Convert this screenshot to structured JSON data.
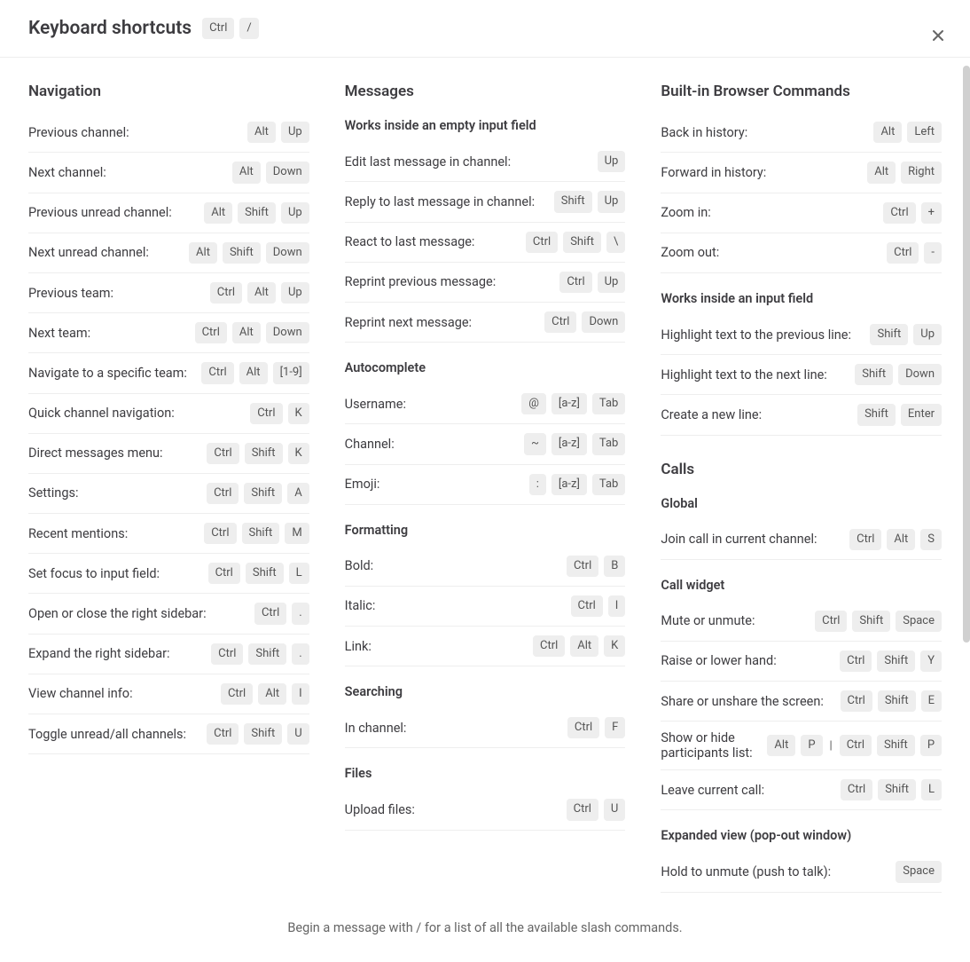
{
  "header": {
    "title": "Keyboard shortcuts",
    "keys": [
      "Ctrl",
      "/"
    ]
  },
  "footer": "Begin a message with / for a list of all the available slash commands.",
  "columns": [
    {
      "sections": [
        {
          "title": "Navigation",
          "groups": [
            {
              "rows": [
                {
                  "label": "Previous channel:",
                  "keys": [
                    "Alt",
                    "Up"
                  ]
                },
                {
                  "label": "Next channel:",
                  "keys": [
                    "Alt",
                    "Down"
                  ]
                },
                {
                  "label": "Previous unread channel:",
                  "keys": [
                    "Alt",
                    "Shift",
                    "Up"
                  ]
                },
                {
                  "label": "Next unread channel:",
                  "keys": [
                    "Alt",
                    "Shift",
                    "Down"
                  ]
                },
                {
                  "label": "Previous team:",
                  "keys": [
                    "Ctrl",
                    "Alt",
                    "Up"
                  ]
                },
                {
                  "label": "Next team:",
                  "keys": [
                    "Ctrl",
                    "Alt",
                    "Down"
                  ]
                },
                {
                  "label": "Navigate to a specific team:",
                  "keys": [
                    "Ctrl",
                    "Alt",
                    "[1-9]"
                  ]
                },
                {
                  "label": "Quick channel navigation:",
                  "keys": [
                    "Ctrl",
                    "K"
                  ]
                },
                {
                  "label": "Direct messages menu:",
                  "keys": [
                    "Ctrl",
                    "Shift",
                    "K"
                  ]
                },
                {
                  "label": "Settings:",
                  "keys": [
                    "Ctrl",
                    "Shift",
                    "A"
                  ]
                },
                {
                  "label": "Recent mentions:",
                  "keys": [
                    "Ctrl",
                    "Shift",
                    "M"
                  ]
                },
                {
                  "label": "Set focus to input field:",
                  "keys": [
                    "Ctrl",
                    "Shift",
                    "L"
                  ]
                },
                {
                  "label": "Open or close the right sidebar:",
                  "keys": [
                    "Ctrl",
                    "."
                  ]
                },
                {
                  "label": "Expand the right sidebar:",
                  "keys": [
                    "Ctrl",
                    "Shift",
                    "."
                  ]
                },
                {
                  "label": "View channel info:",
                  "keys": [
                    "Ctrl",
                    "Alt",
                    "I"
                  ]
                },
                {
                  "label": "Toggle unread/all channels:",
                  "keys": [
                    "Ctrl",
                    "Shift",
                    "U"
                  ]
                }
              ]
            }
          ]
        }
      ]
    },
    {
      "sections": [
        {
          "title": "Messages",
          "groups": [
            {
              "subtitle": "Works inside an empty input field",
              "rows": [
                {
                  "label": "Edit last message in channel:",
                  "keys": [
                    "Up"
                  ]
                },
                {
                  "label": "Reply to last message in channel:",
                  "keys": [
                    "Shift",
                    "Up"
                  ]
                },
                {
                  "label": "React to last message:",
                  "keys": [
                    "Ctrl",
                    "Shift",
                    "\\"
                  ]
                },
                {
                  "label": "Reprint previous message:",
                  "keys": [
                    "Ctrl",
                    "Up"
                  ]
                },
                {
                  "label": "Reprint next message:",
                  "keys": [
                    "Ctrl",
                    "Down"
                  ]
                }
              ]
            },
            {
              "subtitle": "Autocomplete",
              "rows": [
                {
                  "label": "Username:",
                  "keys": [
                    "@",
                    "[a-z]",
                    "Tab"
                  ]
                },
                {
                  "label": "Channel:",
                  "keys": [
                    "~",
                    "[a-z]",
                    "Tab"
                  ]
                },
                {
                  "label": "Emoji:",
                  "keys": [
                    ":",
                    "[a-z]",
                    "Tab"
                  ]
                }
              ]
            },
            {
              "subtitle": "Formatting",
              "rows": [
                {
                  "label": "Bold:",
                  "keys": [
                    "Ctrl",
                    "B"
                  ]
                },
                {
                  "label": "Italic:",
                  "keys": [
                    "Ctrl",
                    "I"
                  ]
                },
                {
                  "label": "Link:",
                  "keys": [
                    "Ctrl",
                    "Alt",
                    "K"
                  ]
                }
              ]
            },
            {
              "subtitle": "Searching",
              "rows": [
                {
                  "label": "In channel:",
                  "keys": [
                    "Ctrl",
                    "F"
                  ]
                }
              ]
            },
            {
              "subtitle": "Files",
              "rows": [
                {
                  "label": "Upload files:",
                  "keys": [
                    "Ctrl",
                    "U"
                  ]
                }
              ]
            }
          ]
        }
      ]
    },
    {
      "sections": [
        {
          "title": "Built-in Browser Commands",
          "groups": [
            {
              "rows": [
                {
                  "label": "Back in history:",
                  "keys": [
                    "Alt",
                    "Left"
                  ]
                },
                {
                  "label": "Forward in history:",
                  "keys": [
                    "Alt",
                    "Right"
                  ]
                },
                {
                  "label": "Zoom in:",
                  "keys": [
                    "Ctrl",
                    "+"
                  ]
                },
                {
                  "label": "Zoom out:",
                  "keys": [
                    "Ctrl",
                    "-"
                  ]
                }
              ]
            },
            {
              "subtitle": "Works inside an input field",
              "rows": [
                {
                  "label": "Highlight text to the previous line:",
                  "keys": [
                    "Shift",
                    "Up"
                  ]
                },
                {
                  "label": "Highlight text to the next line:",
                  "keys": [
                    "Shift",
                    "Down"
                  ]
                },
                {
                  "label": "Create a new line:",
                  "keys": [
                    "Shift",
                    "Enter"
                  ]
                }
              ]
            }
          ]
        },
        {
          "title": "Calls",
          "groups": [
            {
              "subtitle": "Global",
              "rows": [
                {
                  "label": "Join call in current channel:",
                  "keys": [
                    "Ctrl",
                    "Alt",
                    "S"
                  ]
                }
              ]
            },
            {
              "subtitle": "Call widget",
              "rows": [
                {
                  "label": "Mute or unmute:",
                  "keys": [
                    "Ctrl",
                    "Shift",
                    "Space"
                  ]
                },
                {
                  "label": "Raise or lower hand:",
                  "keys": [
                    "Ctrl",
                    "Shift",
                    "Y"
                  ]
                },
                {
                  "label": "Share or unshare the screen:",
                  "keys": [
                    "Ctrl",
                    "Shift",
                    "E"
                  ]
                },
                {
                  "label": "Show or hide participants list:",
                  "keys": [
                    "Alt",
                    "P",
                    "|",
                    "Ctrl",
                    "Shift",
                    "P"
                  ]
                },
                {
                  "label": "Leave current call:",
                  "keys": [
                    "Ctrl",
                    "Shift",
                    "L"
                  ]
                }
              ]
            },
            {
              "subtitle": "Expanded view (pop-out window)",
              "rows": [
                {
                  "label": "Hold to unmute (push to talk):",
                  "keys": [
                    "Space"
                  ]
                }
              ]
            }
          ]
        }
      ]
    }
  ]
}
